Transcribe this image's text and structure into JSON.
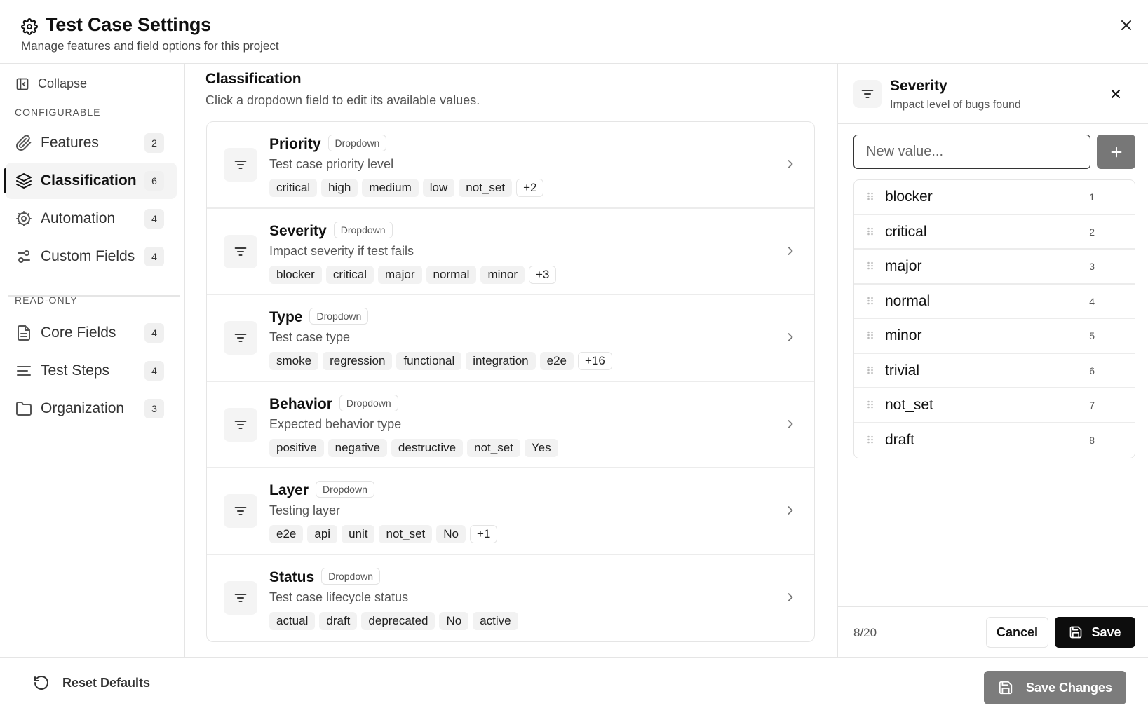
{
  "header": {
    "title": "Test Case Settings",
    "subtitle": "Manage features and field options for this project"
  },
  "sidebar": {
    "collapse_label": "Collapse",
    "configurable_label": "CONFIGURABLE",
    "readonly_label": "READ-ONLY",
    "configurable": [
      {
        "label": "Features",
        "count": "2",
        "icon": "paperclip-icon"
      },
      {
        "label": "Classification",
        "count": "6",
        "icon": "layers-icon",
        "active": true
      },
      {
        "label": "Automation",
        "count": "4",
        "icon": "gear-icon"
      },
      {
        "label": "Custom Fields",
        "count": "4",
        "icon": "sliders-icon"
      }
    ],
    "readonly": [
      {
        "label": "Core Fields",
        "count": "4",
        "icon": "document-icon"
      },
      {
        "label": "Test Steps",
        "count": "4",
        "icon": "list-icon"
      },
      {
        "label": "Organization",
        "count": "3",
        "icon": "folder-icon"
      }
    ]
  },
  "main": {
    "title": "Classification",
    "subtitle": "Click a dropdown field to edit its available values.",
    "fields": [
      {
        "name": "Priority",
        "type": "Dropdown",
        "description": "Test case priority level",
        "values": [
          "critical",
          "high",
          "medium",
          "low",
          "not_set"
        ],
        "more": "+2"
      },
      {
        "name": "Severity",
        "type": "Dropdown",
        "description": "Impact severity if test fails",
        "values": [
          "blocker",
          "critical",
          "major",
          "normal",
          "minor"
        ],
        "more": "+3"
      },
      {
        "name": "Type",
        "type": "Dropdown",
        "description": "Test case type",
        "values": [
          "smoke",
          "regression",
          "functional",
          "integration",
          "e2e"
        ],
        "more": "+16"
      },
      {
        "name": "Behavior",
        "type": "Dropdown",
        "description": "Expected behavior type",
        "values": [
          "positive",
          "negative",
          "destructive",
          "not_set",
          "Yes"
        ],
        "more": ""
      },
      {
        "name": "Layer",
        "type": "Dropdown",
        "description": "Testing layer",
        "values": [
          "e2e",
          "api",
          "unit",
          "not_set",
          "No"
        ],
        "more": "+1"
      },
      {
        "name": "Status",
        "type": "Dropdown",
        "description": "Test case lifecycle status",
        "values": [
          "actual",
          "draft",
          "deprecated",
          "No",
          "active"
        ],
        "more": ""
      }
    ]
  },
  "panel": {
    "title": "Severity",
    "subtitle": "Impact level of bugs found",
    "input_placeholder": "New value...",
    "values": [
      {
        "label": "blocker",
        "index": "1"
      },
      {
        "label": "critical",
        "index": "2"
      },
      {
        "label": "major",
        "index": "3"
      },
      {
        "label": "normal",
        "index": "4"
      },
      {
        "label": "minor",
        "index": "5"
      },
      {
        "label": "trivial",
        "index": "6"
      },
      {
        "label": "not_set",
        "index": "7"
      },
      {
        "label": "draft",
        "index": "8"
      }
    ],
    "count": "8/20",
    "cancel_label": "Cancel",
    "save_label": "Save"
  },
  "footer": {
    "reset_label": "Reset Defaults",
    "save_changes_label": "Save Changes"
  },
  "colors": {
    "primary_button": "#0d0d0d",
    "disabled_button": "#7c7c7c",
    "chip_background": "#f2f2f2"
  }
}
